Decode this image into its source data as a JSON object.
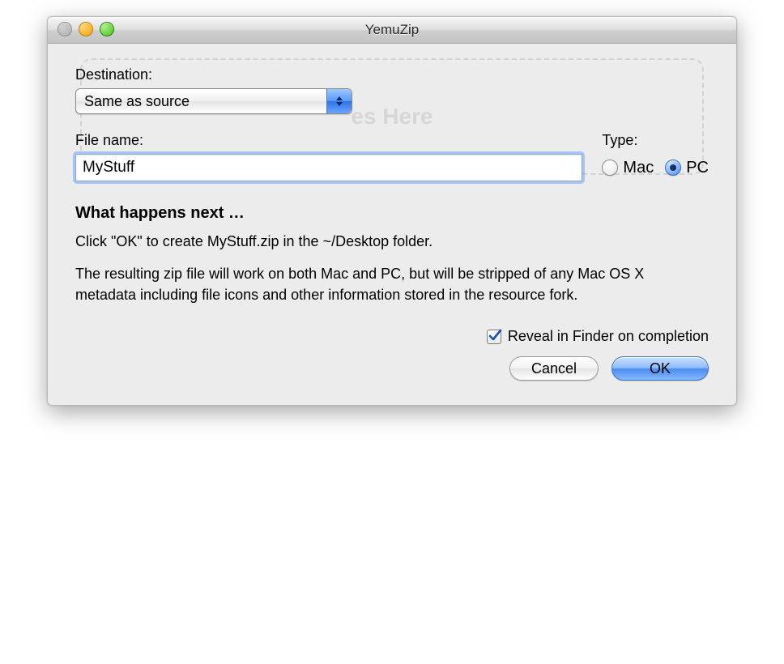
{
  "window": {
    "title": "YemuZip"
  },
  "dropzone": {
    "hint": "es Here"
  },
  "destination": {
    "label": "Destination:",
    "selected": "Same as source"
  },
  "filename": {
    "label": "File name:",
    "value": "MyStuff"
  },
  "type": {
    "label": "Type:",
    "options": [
      {
        "label": "Mac",
        "selected": false
      },
      {
        "label": "PC",
        "selected": true
      }
    ]
  },
  "next": {
    "heading": "What happens next …",
    "line1": "Click \"OK\" to create MyStuff.zip in the ~/Desktop folder.",
    "line2": "The resulting zip file will work on both Mac and PC, but will be stripped of any Mac OS X metadata including file icons and other information stored in the resource fork."
  },
  "reveal": {
    "label": "Reveal in Finder on completion",
    "checked": true
  },
  "buttons": {
    "cancel": "Cancel",
    "ok": "OK"
  }
}
